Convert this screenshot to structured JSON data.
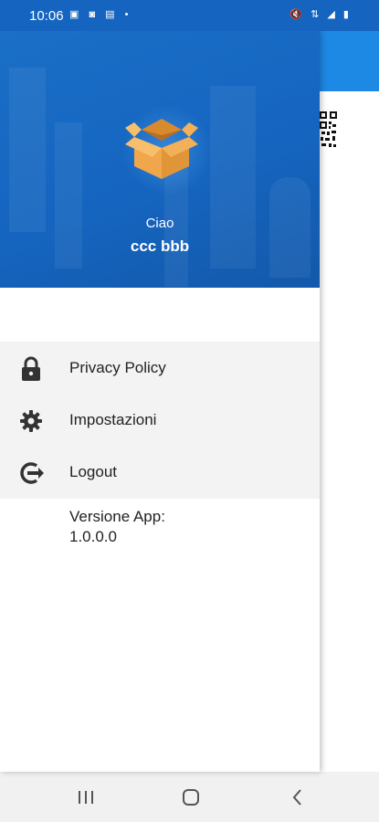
{
  "status_bar": {
    "time": "10:06",
    "left_icons": "▣ ◙ ▤ •",
    "right_icons": "🔇 ⇅ ◢ ▮"
  },
  "drawer": {
    "greeting": "Ciao",
    "user_name": "ccc bbb",
    "menu": [
      {
        "label": "Privacy Policy",
        "icon": "lock-icon"
      },
      {
        "label": "Impostazioni",
        "icon": "gear-icon"
      },
      {
        "label": "Logout",
        "icon": "logout-icon"
      }
    ],
    "version_label": "Versione App:",
    "version_value": "1.0.0.0"
  },
  "colors": {
    "header_blue": "#1565c0",
    "toolbar_blue": "#1e88e5",
    "menu_bg": "#f3f3f3",
    "box_orange": "#f0a64a"
  },
  "nav_bar": {
    "buttons": [
      "recents-icon",
      "home-icon",
      "back-icon"
    ]
  }
}
